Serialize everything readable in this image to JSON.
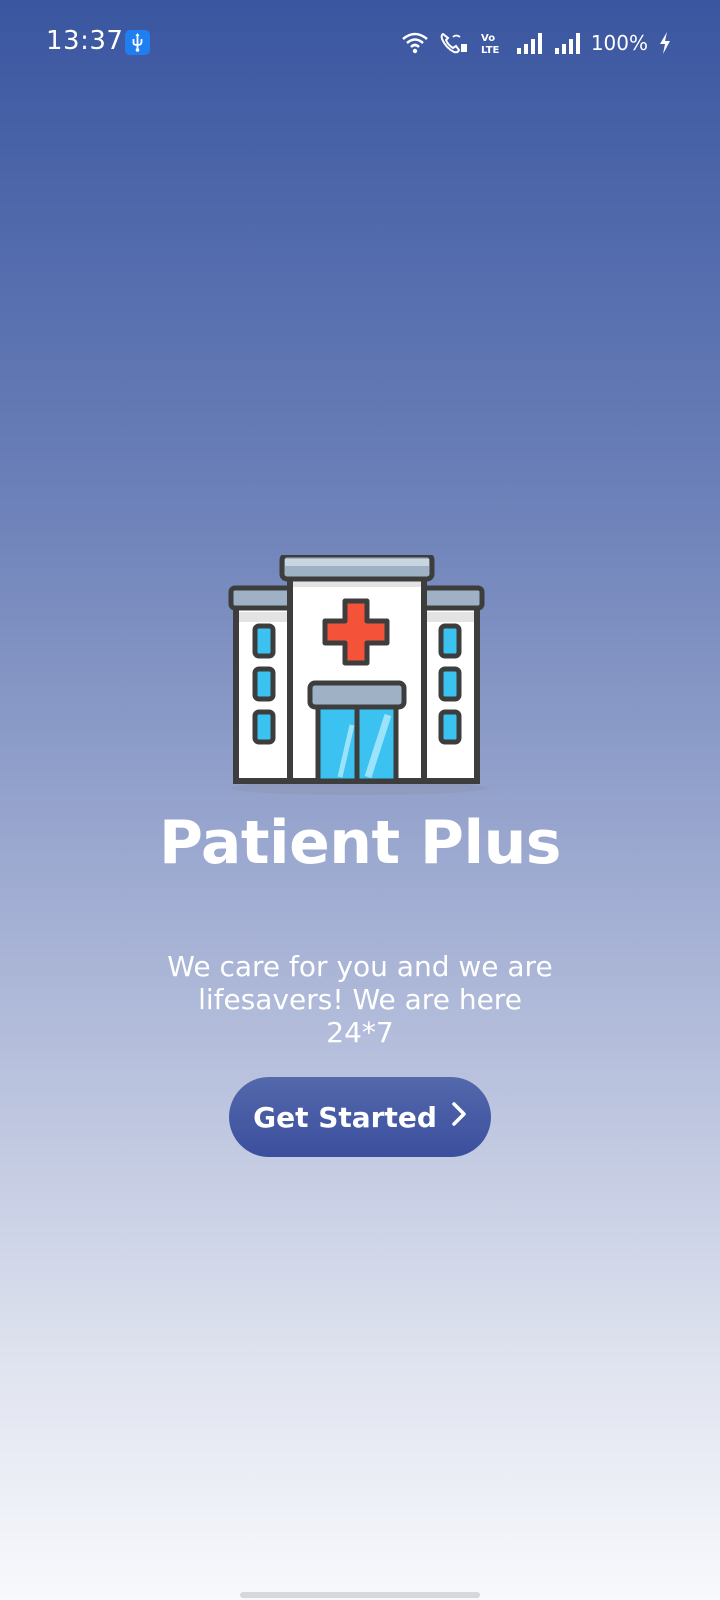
{
  "status_bar": {
    "time": "13:37",
    "usb_icon": "usb-debug-icon",
    "icons": [
      "wifi-icon",
      "wifi-calling-icon",
      "volte-icon",
      "signal-sim1-icon",
      "signal-sim2-icon"
    ],
    "battery": "100%",
    "charging_icon": "lightning-icon"
  },
  "hero": {
    "illustration": "hospital-icon",
    "colors": {
      "cross": "#f4533a",
      "glass": "#3cc2f0",
      "outline": "#3d3d3d",
      "roof": "#9fb2c5"
    }
  },
  "app": {
    "title": "Patient Plus",
    "tagline": "We care for you and we are lifesavers! We are here 24*7"
  },
  "cta": {
    "label": "Get Started",
    "icon": "chevron-right-icon"
  },
  "colors": {
    "gradient_top": "#3a56a0",
    "gradient_bottom": "#f8f9fc",
    "button": "#4257a4",
    "text": "#ffffff"
  }
}
